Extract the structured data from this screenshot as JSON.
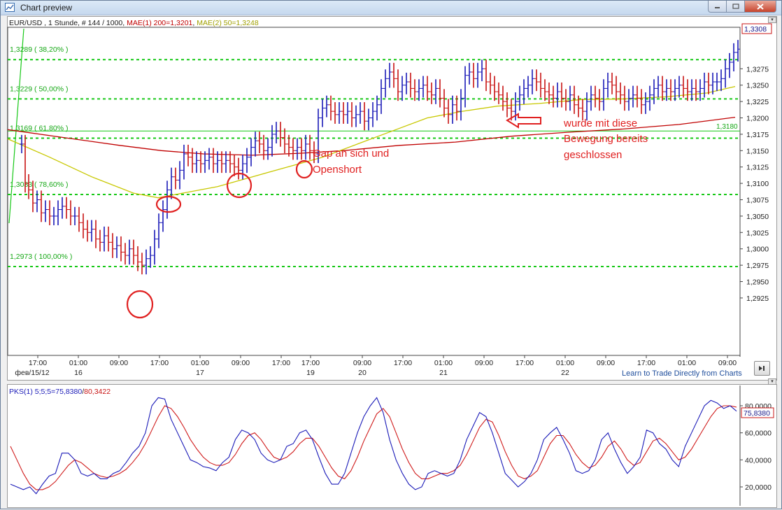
{
  "window": {
    "title": "Chart preview",
    "minimize_icon": "minimize-icon",
    "maximize_icon": "maximize-icon",
    "close_icon": "close-icon"
  },
  "price_chart": {
    "header": {
      "symbol": "EUR/USD , 1 Stunde, # 144 / 1000, ",
      "mae1": "MAE(1) 200=1,3201",
      "sep": ", ",
      "mae2": "MAE(2) 50=1,3248"
    },
    "colors": {
      "up_bar": "#1b1bb8",
      "down_bar": "#c81414",
      "mae1": "#c00000",
      "mae2": "#c8c800",
      "fib": "#17c817",
      "annotation": "#e02020"
    },
    "y_ticks": [
      "1,3308",
      "1,3275",
      "1,3250",
      "1,3225",
      "1,3200",
      "1,3175",
      "1,3150",
      "1,3125",
      "1,3100",
      "1,3075",
      "1,3050",
      "1,3025",
      "1,3000",
      "1,2975",
      "1,2950",
      "1,2925"
    ],
    "current_price": "1,3308",
    "fib_levels": [
      {
        "label": "1,3289 ( 38,20% )",
        "value": 1.3289
      },
      {
        "label": "1,3229 ( 50,00% )",
        "value": 1.3229
      },
      {
        "label": "1,3169 ( 61,80% )",
        "value": 1.3169
      },
      {
        "label": "1,3083 ( 78,60% )",
        "value": 1.3083
      },
      {
        "label": "1,2973 ( 100,00% )",
        "value": 1.2973
      }
    ],
    "hline_value_label": "1,3180",
    "x_labels_time": [
      "17:00",
      "01:00",
      "09:00",
      "17:00",
      "01:00",
      "09:00",
      "17:00",
      "17:00",
      "09:00",
      "17:00",
      "01:00",
      "09:00",
      "17:00",
      "01:00",
      "09:00",
      "17:00",
      "01:00",
      "09:00"
    ],
    "x_labels_date": [
      "фев/15/12",
      "16",
      "17",
      "19",
      "20",
      "21",
      "22"
    ],
    "annotations": {
      "gap_line1": "Gap an sich und",
      "gap_line2": "Openshort",
      "note_line1": "wurde mit diese",
      "note_line2": "Bewegung bereits",
      "note_line3": "geschlossen"
    },
    "learn_link": "Learn to Trade Directly from Charts"
  },
  "oscillator": {
    "header_blue": "PKS(1) 5;5;5=75,8380",
    "header_sep": "/",
    "header_red": "80,3422",
    "y_ticks": [
      "80,0000",
      "60,0000",
      "40,0000",
      "20,0000"
    ],
    "current_value": "75,8380"
  },
  "chart_data": {
    "type": "line",
    "price_range": [
      1.2925,
      1.3308
    ],
    "oscillator_range": [
      0,
      100
    ],
    "mae1_path": [
      [
        0,
        1.3182
      ],
      [
        80,
        1.317
      ],
      [
        160,
        1.3158
      ],
      [
        220,
        1.315
      ],
      [
        280,
        1.3145
      ],
      [
        350,
        1.3143
      ],
      [
        420,
        1.3146
      ],
      [
        480,
        1.315
      ],
      [
        560,
        1.3158
      ],
      [
        640,
        1.3163
      ],
      [
        720,
        1.3172
      ],
      [
        800,
        1.3178
      ],
      [
        880,
        1.3183
      ],
      [
        960,
        1.319
      ],
      [
        1040,
        1.3201
      ]
    ],
    "mae2_path": [
      [
        0,
        1.3168
      ],
      [
        60,
        1.314
      ],
      [
        120,
        1.311
      ],
      [
        180,
        1.3085
      ],
      [
        215,
        1.3078
      ],
      [
        250,
        1.3085
      ],
      [
        300,
        1.3095
      ],
      [
        350,
        1.311
      ],
      [
        400,
        1.3125
      ],
      [
        450,
        1.314
      ],
      [
        500,
        1.316
      ],
      [
        550,
        1.318
      ],
      [
        600,
        1.32
      ],
      [
        650,
        1.321
      ],
      [
        700,
        1.3218
      ],
      [
        760,
        1.3222
      ],
      [
        820,
        1.3228
      ],
      [
        880,
        1.3229
      ],
      [
        940,
        1.3232
      ],
      [
        1000,
        1.3238
      ],
      [
        1040,
        1.3248
      ]
    ]
  }
}
